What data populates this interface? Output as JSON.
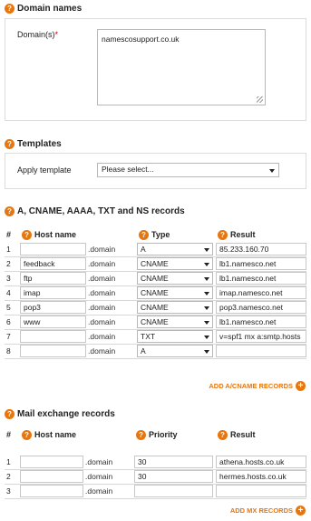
{
  "domain_names": {
    "title": "Domain names",
    "label": "Domain(s)",
    "required_mark": "*",
    "value": "namescosupport.co.uk"
  },
  "templates": {
    "title": "Templates",
    "label": "Apply template",
    "selected": "Please select..."
  },
  "records": {
    "title": "A, CNAME, AAAA, TXT and NS records",
    "headers": {
      "num": "#",
      "host": "Host name",
      "type": "Type",
      "result": "Result"
    },
    "rows": [
      {
        "num": "1",
        "host": "",
        "domain": ".domain",
        "type": "A",
        "result": "85.233.160.70"
      },
      {
        "num": "2",
        "host": "feedback",
        "domain": ".domain",
        "type": "CNAME",
        "result": "lb1.namesco.net"
      },
      {
        "num": "3",
        "host": "ftp",
        "domain": ".domain",
        "type": "CNAME",
        "result": "lb1.namesco.net"
      },
      {
        "num": "4",
        "host": "imap",
        "domain": ".domain",
        "type": "CNAME",
        "result": "imap.namesco.net"
      },
      {
        "num": "5",
        "host": "pop3",
        "domain": ".domain",
        "type": "CNAME",
        "result": "pop3.namesco.net"
      },
      {
        "num": "6",
        "host": "www",
        "domain": ".domain",
        "type": "CNAME",
        "result": "lb1.namesco.net"
      },
      {
        "num": "7",
        "host": "",
        "domain": ".domain",
        "type": "TXT",
        "result": "v=spf1 mx a:smtp.hosts"
      },
      {
        "num": "8",
        "host": "",
        "domain": ".domain",
        "type": "A",
        "result": ""
      }
    ],
    "add_label": "ADD A/CNAME RECORDS"
  },
  "mx": {
    "title": "Mail exchange records",
    "headers": {
      "num": "#",
      "host": "Host name",
      "priority": "Priority",
      "result": "Result"
    },
    "rows": [
      {
        "num": "1",
        "host": "",
        "domain": ".domain",
        "priority": "30",
        "result": "athena.hosts.co.uk"
      },
      {
        "num": "2",
        "host": "",
        "domain": ".domain",
        "priority": "30",
        "result": "hermes.hosts.co.uk"
      },
      {
        "num": "3",
        "host": "",
        "domain": ".domain",
        "priority": "",
        "result": ""
      }
    ],
    "add_label": "ADD MX RECORDS"
  },
  "colors": {
    "accent": "#e8760f",
    "required": "#cc0000",
    "border": "#dcdcdc"
  },
  "icons": {
    "help": "question-circle-icon",
    "add": "plus-circle-icon",
    "dropdown": "chevron-down-icon"
  }
}
